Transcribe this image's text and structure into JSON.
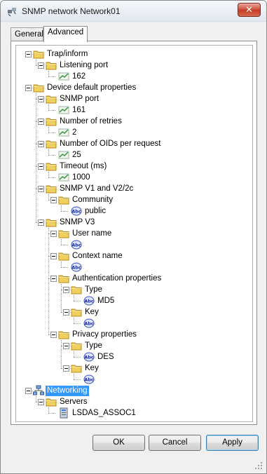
{
  "window": {
    "title": "SNMP network Network01",
    "close_label": "✕"
  },
  "tabs": [
    {
      "label": "General",
      "active": false
    },
    {
      "label": "Advanced",
      "active": true
    }
  ],
  "tree": {
    "nodes": [
      {
        "level": 0,
        "label": "Trap/inform",
        "icon": "folder-icon",
        "expander": true
      },
      {
        "level": 1,
        "label": "Listening port",
        "icon": "folder-icon",
        "expander": true
      },
      {
        "level": 2,
        "label": "162",
        "icon": "numeric-value-icon",
        "expander": false
      },
      {
        "level": 0,
        "label": "Device default properties",
        "icon": "folder-icon",
        "expander": true
      },
      {
        "level": 1,
        "label": "SNMP port",
        "icon": "folder-icon",
        "expander": true
      },
      {
        "level": 2,
        "label": "161",
        "icon": "numeric-value-icon",
        "expander": false
      },
      {
        "level": 1,
        "label": "Number of retries",
        "icon": "folder-icon",
        "expander": true
      },
      {
        "level": 2,
        "label": "2",
        "icon": "numeric-value-icon",
        "expander": false
      },
      {
        "level": 1,
        "label": "Number of OIDs per request",
        "icon": "folder-icon",
        "expander": true
      },
      {
        "level": 2,
        "label": "25",
        "icon": "numeric-value-icon",
        "expander": false
      },
      {
        "level": 1,
        "label": "Timeout (ms)",
        "icon": "folder-icon",
        "expander": true
      },
      {
        "level": 2,
        "label": "1000",
        "icon": "numeric-value-icon",
        "expander": false
      },
      {
        "level": 1,
        "label": "SNMP V1 and V2/2c",
        "icon": "folder-icon",
        "expander": true
      },
      {
        "level": 2,
        "label": "Community",
        "icon": "folder-icon",
        "expander": true
      },
      {
        "level": 3,
        "label": "public",
        "icon": "string-value-icon",
        "expander": false
      },
      {
        "level": 1,
        "label": "SNMP V3",
        "icon": "folder-icon",
        "expander": true
      },
      {
        "level": 2,
        "label": "User name",
        "icon": "folder-icon",
        "expander": true
      },
      {
        "level": 3,
        "label": "",
        "icon": "string-value-icon",
        "expander": false
      },
      {
        "level": 2,
        "label": "Context name",
        "icon": "folder-icon",
        "expander": true
      },
      {
        "level": 3,
        "label": "",
        "icon": "string-value-icon",
        "expander": false
      },
      {
        "level": 2,
        "label": "Authentication properties",
        "icon": "folder-icon",
        "expander": true
      },
      {
        "level": 3,
        "label": "Type",
        "icon": "folder-icon",
        "expander": true
      },
      {
        "level": 4,
        "label": "MD5",
        "icon": "string-value-icon",
        "expander": false
      },
      {
        "level": 3,
        "label": "Key",
        "icon": "folder-icon",
        "expander": true
      },
      {
        "level": 4,
        "label": "",
        "icon": "string-value-icon",
        "expander": false
      },
      {
        "level": 2,
        "label": "Privacy properties",
        "icon": "folder-icon",
        "expander": true
      },
      {
        "level": 3,
        "label": "Type",
        "icon": "folder-icon",
        "expander": true
      },
      {
        "level": 4,
        "label": "DES",
        "icon": "string-value-icon",
        "expander": false
      },
      {
        "level": 3,
        "label": "Key",
        "icon": "folder-icon",
        "expander": true
      },
      {
        "level": 4,
        "label": "",
        "icon": "string-value-icon",
        "expander": false
      },
      {
        "level": 0,
        "label": "Networking",
        "icon": "network-icon",
        "expander": true,
        "selected": true
      },
      {
        "level": 1,
        "label": "Servers",
        "icon": "folder-icon",
        "expander": true
      },
      {
        "level": 2,
        "label": "LSDAS_ASSOC1",
        "icon": "server-icon",
        "expander": false
      }
    ]
  },
  "buttons": {
    "ok": "OK",
    "cancel": "Cancel",
    "apply": "Apply"
  },
  "colors": {
    "selection": "#3399ff",
    "folder": "#e8c24a",
    "close": "#c43a26"
  }
}
